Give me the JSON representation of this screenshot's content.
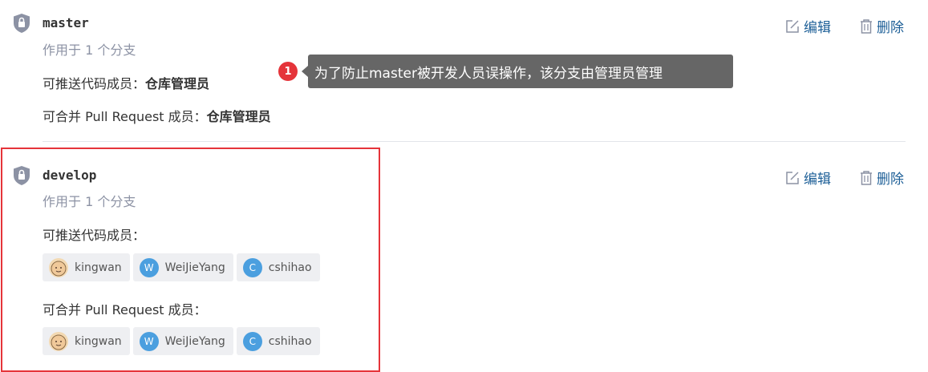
{
  "branches": [
    {
      "name": "master",
      "applies": "作用于 1 个分支",
      "push_label": "可推送代码成员：",
      "push_value": "仓库管理员",
      "merge_label": "可合并 Pull Request 成员：",
      "merge_value": "仓库管理员",
      "edit_label": "编辑",
      "delete_label": "删除"
    },
    {
      "name": "develop",
      "applies": "作用于 1 个分支",
      "push_label": "可推送代码成员：",
      "merge_label": "可合并 Pull Request 成员：",
      "edit_label": "编辑",
      "delete_label": "删除",
      "push_members": [
        {
          "name": "kingwan",
          "avatar": "cartoon-avatar"
        },
        {
          "name": "WeiJieYang",
          "avatar_letter": "W"
        },
        {
          "name": "cshihao",
          "avatar_letter": "C"
        }
      ],
      "merge_members": [
        {
          "name": "kingwan",
          "avatar": "cartoon-avatar"
        },
        {
          "name": "WeiJieYang",
          "avatar_letter": "W"
        },
        {
          "name": "cshihao",
          "avatar_letter": "C"
        }
      ]
    }
  ],
  "annotation": {
    "badge": "1",
    "text": "为了防止master被开发人员误操作，该分支由管理员管理"
  },
  "colors": {
    "link": "#1d5f97",
    "highlight": "#e5343a",
    "avatar": "#4b9fdf",
    "tooltip_bg": "#666666"
  },
  "icons": [
    "lock-shield-icon",
    "edit-icon",
    "trash-icon"
  ]
}
